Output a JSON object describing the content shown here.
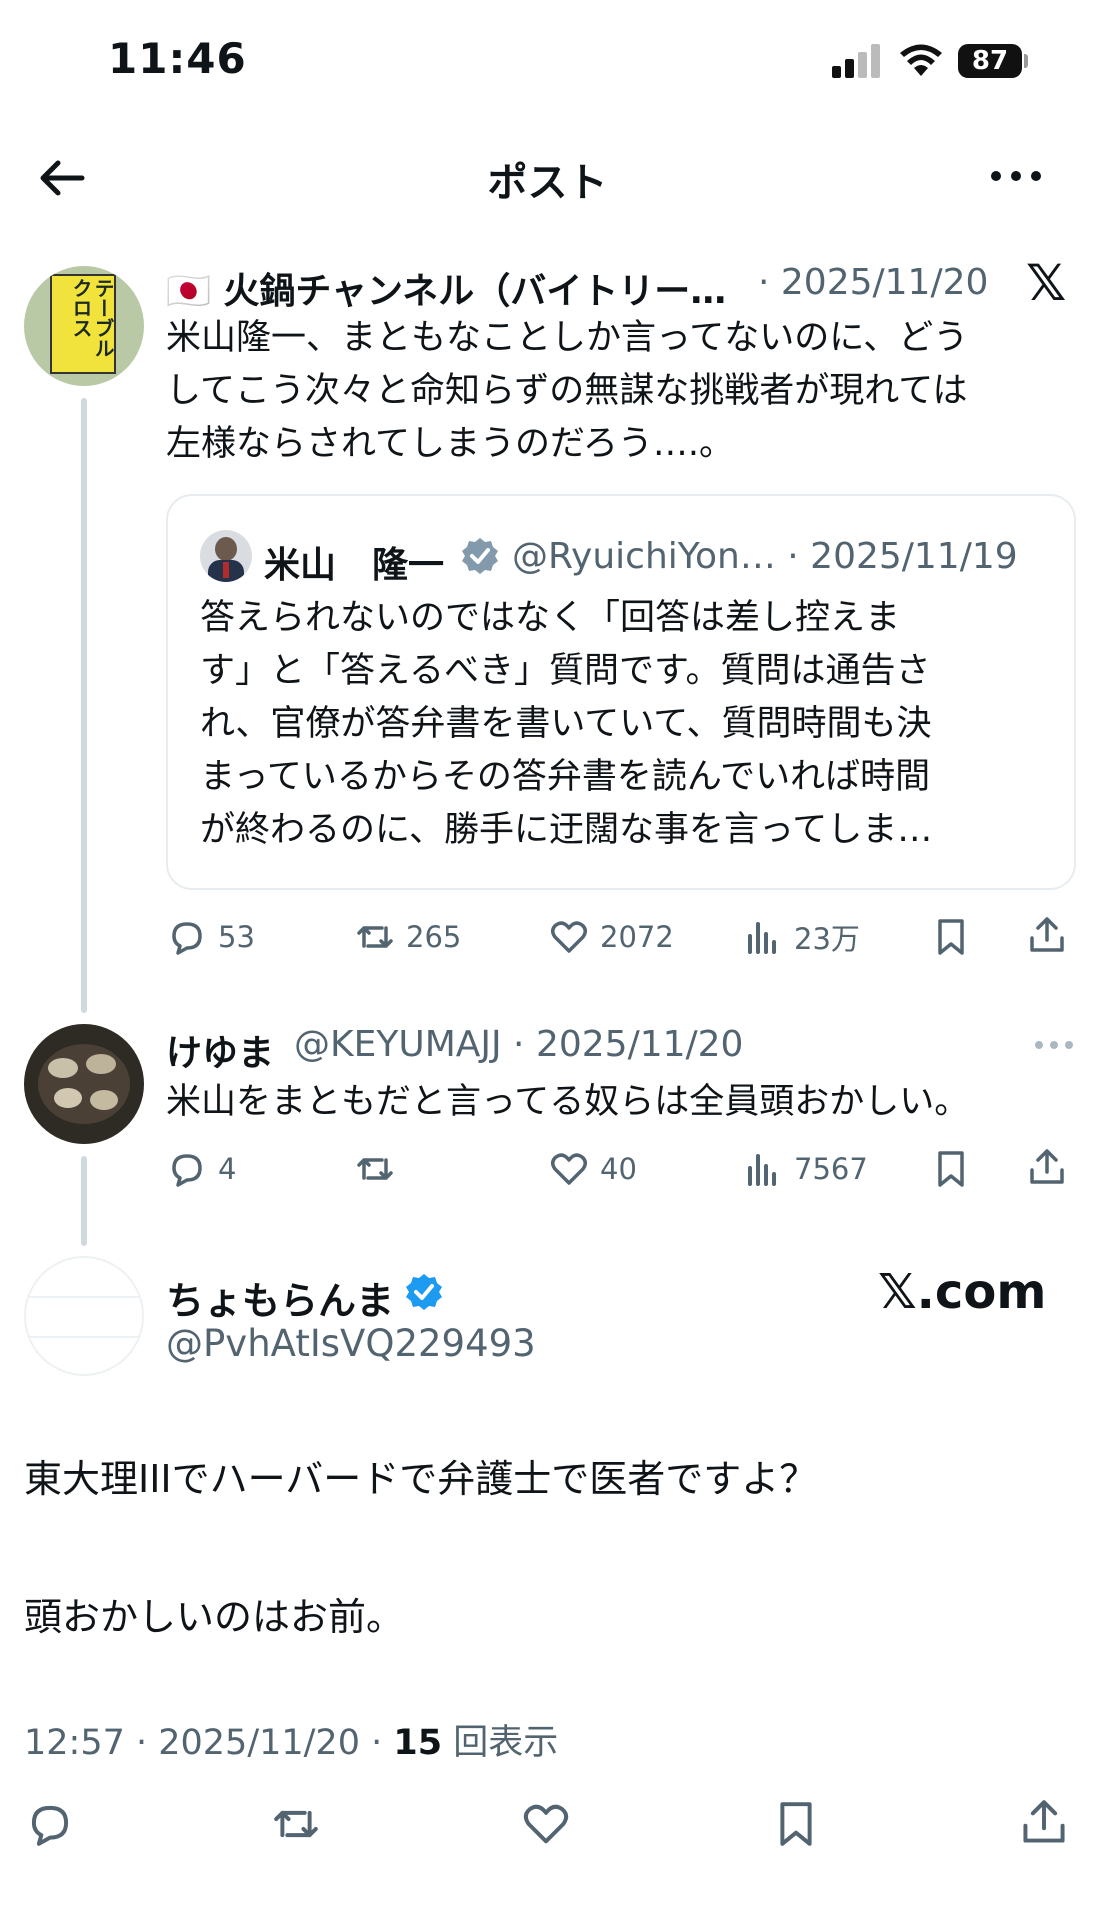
{
  "status_bar": {
    "time": "11:46",
    "battery": "87"
  },
  "nav": {
    "title": "ポスト"
  },
  "post1": {
    "display_name": "🇯🇵 火鍋チャンネル（バイトリー…",
    "date": "· 2025/11/20",
    "avatar_text": "テーブルクロス",
    "text_lines": [
      "米山隆一、まともなことしか言ってないのに、どう",
      "してこう次々と命知らずの無謀な挑戦者が現れては",
      "左様ならされてしまうのだろう….。"
    ],
    "quote": {
      "display_name": "米山　隆一",
      "handle_date": "@RyuichiYon… · 2025/11/19",
      "text_lines": [
        "答えられないのではなく「回答は差し控えま",
        "す」と「答えるべき」質問です。質問は通告さ",
        "れ、官僚が答弁書を書いていて、質問時間も決",
        "まっているからその答弁書を読んでいれば時間",
        "が終わるのに、勝手に迂闊な事を言ってしま…"
      ]
    },
    "actions": {
      "replies": "53",
      "reposts": "265",
      "likes": "2072",
      "views": "23万"
    }
  },
  "post2": {
    "display_name": "けゆま",
    "handle_date": "@KEYUMAJJ · 2025/11/20",
    "text": "米山をまともだと言ってる奴らは全員頭おかしい。",
    "actions": {
      "replies": "4",
      "reposts": "",
      "likes": "40",
      "views": "7567"
    }
  },
  "main_post": {
    "display_name": "ちょもらんま",
    "handle": "@PvhAtIsVQ229493",
    "watermark": "𝕏.com",
    "text_line1": "東大理IIIでハーバードで弁護士で医者ですよ？",
    "text_line2": "頭おかしいのはお前。",
    "time": "12:57 · 2025/11/20 · ",
    "views_count": "15",
    "views_label": " 回表示"
  },
  "colors": {
    "accent": "#1d9bf0",
    "secondary_text": "#536471",
    "border": "#e6ecf0"
  }
}
